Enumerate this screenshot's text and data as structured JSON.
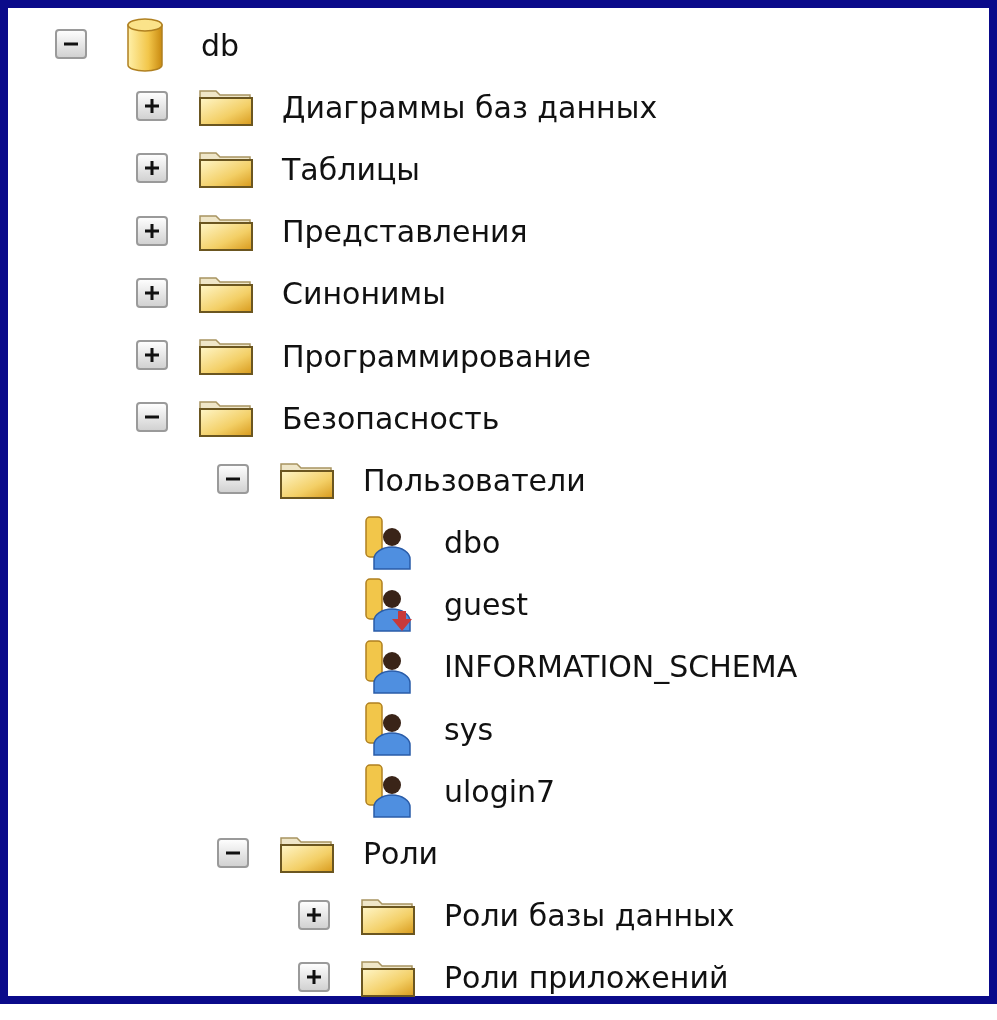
{
  "tree": [
    {
      "label": "db",
      "kind": "database",
      "expanded": true,
      "children": [
        {
          "label": "Диаграммы баз данных",
          "kind": "folder",
          "expanded": false
        },
        {
          "label": "Таблицы",
          "kind": "folder",
          "expanded": false
        },
        {
          "label": "Представления",
          "kind": "folder",
          "expanded": false
        },
        {
          "label": "Синонимы",
          "kind": "folder",
          "expanded": false
        },
        {
          "label": "Программирование",
          "kind": "folder",
          "expanded": false
        },
        {
          "label": "Безопасность",
          "kind": "folder",
          "expanded": true,
          "children": [
            {
              "label": "Пользователи",
              "kind": "folder",
              "expanded": true,
              "children": [
                {
                  "label": "dbo",
                  "kind": "user"
                },
                {
                  "label": "guest",
                  "kind": "user-denied"
                },
                {
                  "label": "INFORMATION_SCHEMA",
                  "kind": "user"
                },
                {
                  "label": "sys",
                  "kind": "user"
                },
                {
                  "label": "ulogin7",
                  "kind": "user"
                }
              ]
            },
            {
              "label": "Роли",
              "kind": "folder",
              "expanded": true,
              "children": [
                {
                  "label": "Роли базы данных",
                  "kind": "folder",
                  "expanded": false
                },
                {
                  "label": "Роли приложений",
                  "kind": "folder",
                  "expanded": false
                }
              ]
            }
          ]
        }
      ]
    }
  ]
}
